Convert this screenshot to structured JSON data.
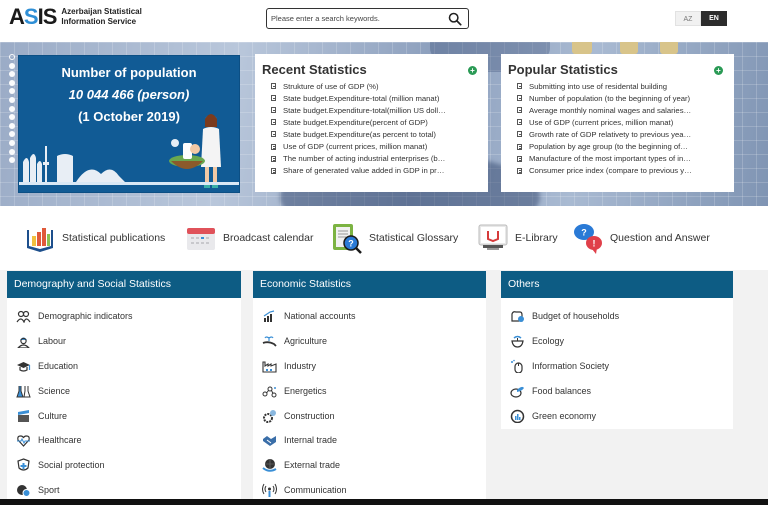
{
  "header": {
    "logo_mark": "ASIS",
    "logo_text_line1": "Azerbaijan Statistical",
    "logo_text_line2": "Information Service",
    "search_placeholder": "Please enter a search keywords.",
    "languages": [
      {
        "code": "AZ",
        "active": false
      },
      {
        "code": "EN",
        "active": true
      }
    ]
  },
  "slider": {
    "dot_count": 13,
    "active_index": 0,
    "title": "Number of population",
    "value": "10 044 466 (person)",
    "date": "(1 October 2019)"
  },
  "recent": {
    "title": "Recent Statistics",
    "more_icon": "plus-circle-icon",
    "items": [
      "Strukture of use of GDP (%)",
      "State budget.Expenditure-total (million manat)",
      "State budget.Expenditure-total(million US doll…",
      "State budget.Expenditure(percent of GDP)",
      "State budget.Expenditure(as percent to total)",
      "Use of GDP (current prices, million manat)",
      "The number of acting industrial enterprises (b…",
      "Share of generated value added in GDP in pr…"
    ]
  },
  "popular": {
    "title": "Popular Statistics",
    "more_icon": "plus-circle-icon",
    "items": [
      "Submitting into use of residental building",
      "Number of population (to the beginning of year)",
      "Average monthly nominal wages and salaries…",
      "Use of GDP (current prices, million manat)",
      "Growth rate of GDP relativety to previous yea…",
      "Population by age group (to the beginning of…",
      "Manufacture of the most important types of in…",
      "Consumer price index (compare to previous y…"
    ]
  },
  "quick_links": [
    {
      "label": "Statistical publications",
      "icon": "publications-chart-icon"
    },
    {
      "label": "Broadcast calendar",
      "icon": "calendar-icon"
    },
    {
      "label": "Statistical Glossary",
      "icon": "glossary-magnifier-icon"
    },
    {
      "label": "E-Library",
      "icon": "monitor-book-icon"
    },
    {
      "label": "Question and Answer",
      "icon": "question-answer-bubbles-icon"
    }
  ],
  "categories": [
    {
      "title": "Demography and Social Statistics",
      "items": [
        {
          "label": "Demographic indicators",
          "icon": "people-group-icon"
        },
        {
          "label": "Labour",
          "icon": "worker-icon"
        },
        {
          "label": "Education",
          "icon": "graduation-cap-icon"
        },
        {
          "label": "Science",
          "icon": "flask-icon"
        },
        {
          "label": "Culture",
          "icon": "clapperboard-icon"
        },
        {
          "label": "Healthcare",
          "icon": "heart-pulse-icon"
        },
        {
          "label": "Social protection",
          "icon": "shield-cross-icon"
        },
        {
          "label": "Sport",
          "icon": "balls-icon"
        }
      ]
    },
    {
      "title": "Economic Statistics",
      "items": [
        {
          "label": "National accounts",
          "icon": "growth-chart-icon"
        },
        {
          "label": "Agriculture",
          "icon": "hand-plant-icon"
        },
        {
          "label": "Industry",
          "icon": "factory-icon"
        },
        {
          "label": "Energetics",
          "icon": "energy-nodes-icon"
        },
        {
          "label": "Construction",
          "icon": "gears-icon"
        },
        {
          "label": "Internal trade",
          "icon": "handshake-icon"
        },
        {
          "label": "External trade",
          "icon": "globe-hand-icon"
        },
        {
          "label": "Communication",
          "icon": "antenna-icon"
        }
      ]
    },
    {
      "title": "Others",
      "items": [
        {
          "label": "Budget of households",
          "icon": "wallet-coin-icon"
        },
        {
          "label": "Ecology",
          "icon": "bowl-sprout-icon"
        },
        {
          "label": "Information Society",
          "icon": "mouse-cursor-icon"
        },
        {
          "label": "Food balances",
          "icon": "food-plate-icon"
        },
        {
          "label": "Green economy",
          "icon": "eco-gauge-icon"
        }
      ]
    }
  ],
  "colors": {
    "brand_blue": "#0d5c84",
    "slide_blue": "#115b95",
    "accent_green": "#2a9a55",
    "logo_blue": "#2f8fd6"
  }
}
